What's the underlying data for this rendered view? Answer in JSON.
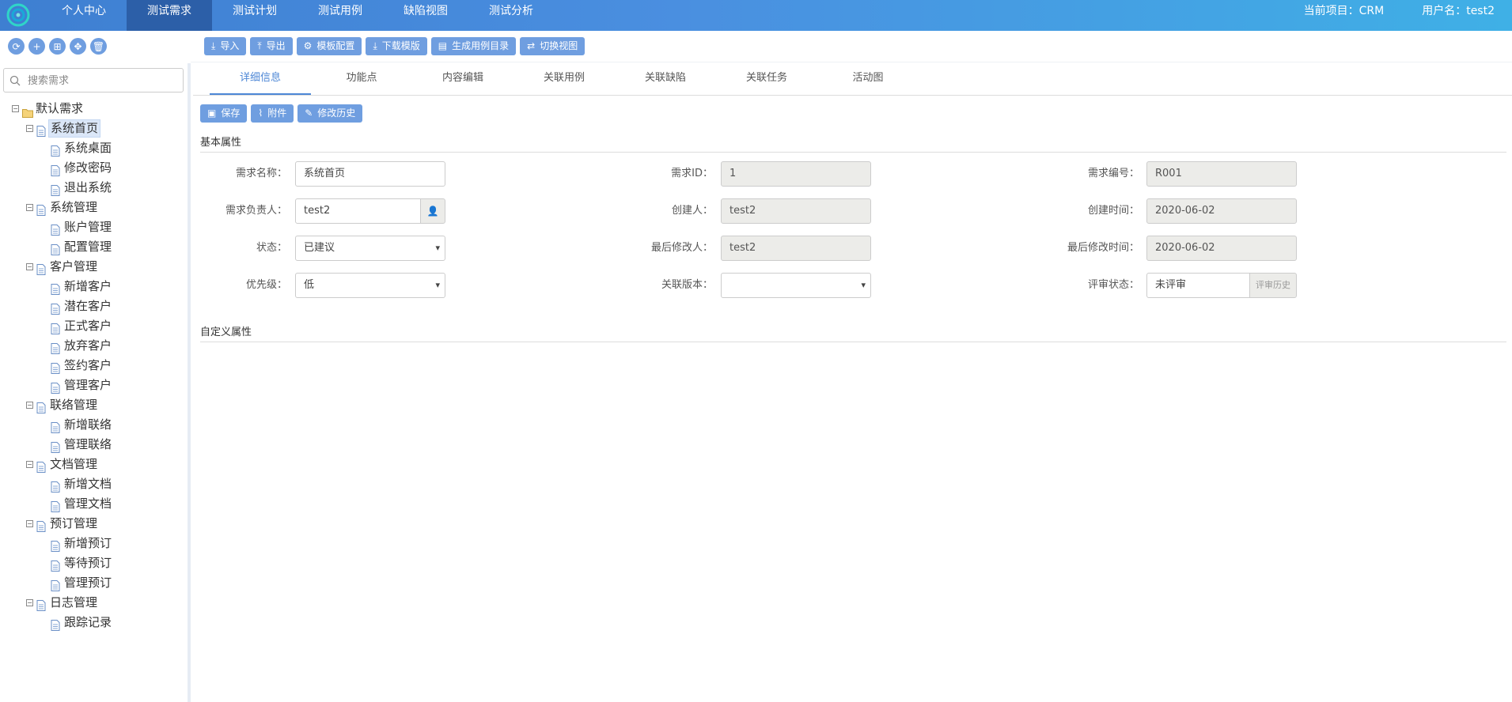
{
  "nav": {
    "items": [
      "个人中心",
      "测试需求",
      "测试计划",
      "测试用例",
      "缺陷视图",
      "测试分析"
    ],
    "active_index": 1,
    "current_project": "当前项目：CRM",
    "username": "用户名：test2"
  },
  "left_tools": [
    "refresh-icon",
    "add-icon",
    "grid-icon",
    "move-icon",
    "delete-icon"
  ],
  "search": {
    "placeholder": "搜索需求",
    "value": ""
  },
  "tree": [
    {
      "label": "默认需求",
      "level": 0,
      "type": "folder"
    },
    {
      "label": "系统首页",
      "level": 1,
      "type": "group",
      "selected": true
    },
    {
      "label": "系统桌面",
      "level": 2
    },
    {
      "label": "修改密码",
      "level": 2
    },
    {
      "label": "退出系统",
      "level": 2
    },
    {
      "label": "系统管理",
      "level": 1,
      "type": "group"
    },
    {
      "label": "账户管理",
      "level": 2
    },
    {
      "label": "配置管理",
      "level": 2
    },
    {
      "label": "客户管理",
      "level": 1,
      "type": "group"
    },
    {
      "label": "新增客户",
      "level": 2
    },
    {
      "label": "潜在客户",
      "level": 2
    },
    {
      "label": "正式客户",
      "level": 2
    },
    {
      "label": "放弃客户",
      "level": 2
    },
    {
      "label": "签约客户",
      "level": 2
    },
    {
      "label": "管理客户",
      "level": 2
    },
    {
      "label": "联络管理",
      "level": 1,
      "type": "group"
    },
    {
      "label": "新增联络",
      "level": 2
    },
    {
      "label": "管理联络",
      "level": 2
    },
    {
      "label": "文档管理",
      "level": 1,
      "type": "group"
    },
    {
      "label": "新增文档",
      "level": 2
    },
    {
      "label": "管理文档",
      "level": 2
    },
    {
      "label": "预订管理",
      "level": 1,
      "type": "group"
    },
    {
      "label": "新增预订",
      "level": 2
    },
    {
      "label": "等待预订",
      "level": 2
    },
    {
      "label": "管理预订",
      "level": 2
    },
    {
      "label": "日志管理",
      "level": 1,
      "type": "group"
    },
    {
      "label": "跟踪记录",
      "level": 2
    }
  ],
  "toolbar": {
    "import": "导入",
    "export": "导出",
    "template_config": "模板配置",
    "download_template": "下载模版",
    "gen_case_dir": "生成用例目录",
    "switch_view": "切换视图"
  },
  "tabs": [
    "详细信息",
    "功能点",
    "内容编辑",
    "关联用例",
    "关联缺陷",
    "关联任务",
    "活动图"
  ],
  "actions": {
    "save": "保存",
    "attach": "附件",
    "history": "修改历史"
  },
  "sections": {
    "basic": "基本属性",
    "custom": "自定义属性"
  },
  "form": {
    "name_label": "需求名称：",
    "name_value": "系统首页",
    "id_label": "需求ID：",
    "id_value": "1",
    "code_label": "需求编号：",
    "code_value": "R001",
    "owner_label": "需求负责人：",
    "owner_value": "test2",
    "creator_label": "创建人：",
    "creator_value": "test2",
    "created_label": "创建时间：",
    "created_value": "2020-06-02",
    "status_label": "状态：",
    "status_value": "已建议",
    "modifier_label": "最后修改人：",
    "modifier_value": "test2",
    "modified_label": "最后修改时间：",
    "modified_value": "2020-06-02",
    "priority_label": "优先级：",
    "priority_value": "低",
    "version_label": "关联版本：",
    "version_value": "",
    "review_label": "评审状态：",
    "review_value": "未评审",
    "review_history": "评审历史"
  }
}
